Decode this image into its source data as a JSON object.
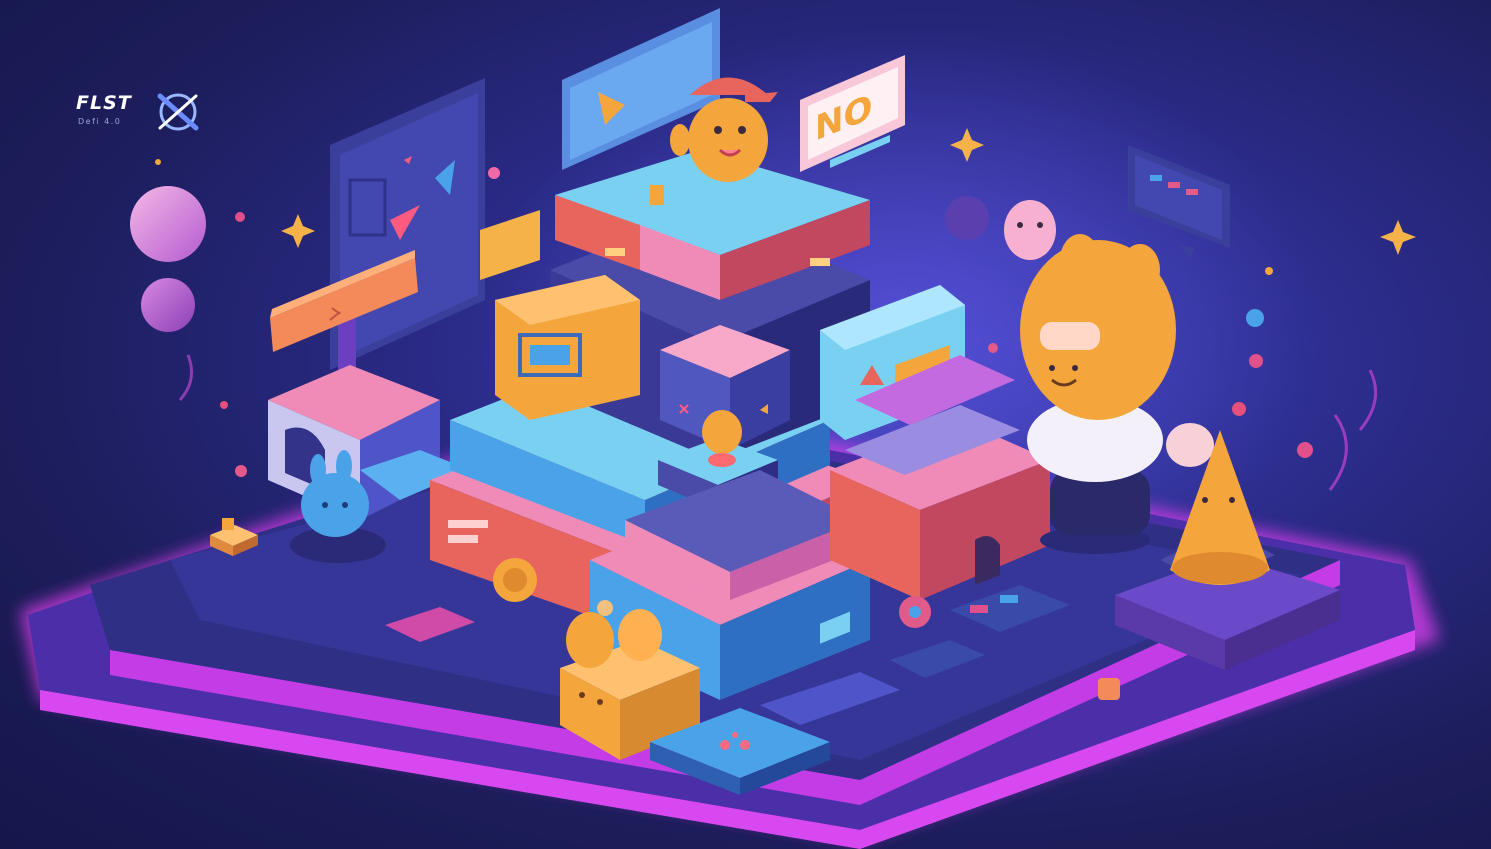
{
  "brand": {
    "name": "FLST",
    "tagline": "Defi 4.0",
    "logo_icon": "crossed-circle-logo-icon"
  },
  "illustration": {
    "subject": "isometric-game-world-platform-icon",
    "sign_text": "NO"
  },
  "colors": {
    "background": "#1c1d5a",
    "neon_edge": "#e040f0",
    "orange": "#f4a53c",
    "blue": "#4aa3e8",
    "coral": "#e8655e",
    "pink": "#f08bb8",
    "navy": "#2f2f86"
  }
}
